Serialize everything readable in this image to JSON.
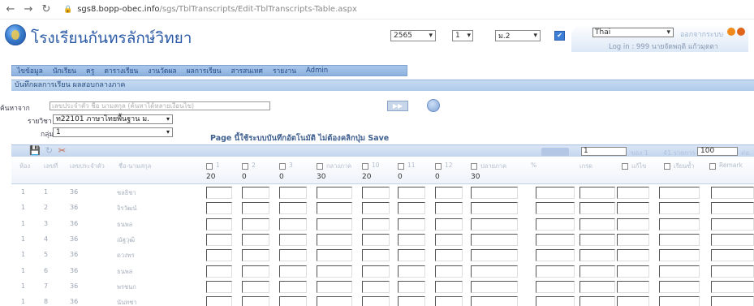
{
  "browser": {
    "back_icon": "back-arrow-icon",
    "forward_icon": "forward-arrow-icon",
    "reload_icon": "reload-icon",
    "lock_icon": "lock-icon",
    "url_host": "sgs8.bopp-obec.info",
    "url_path": "/sgs/TblTranscripts/Edit-TblTranscripts-Table.aspx"
  },
  "header": {
    "school_name": "โรงเรียนกันทรลักษ์วิทยา",
    "year_value": "2565",
    "term_value": "1",
    "class_label": "",
    "level_value": "ม.2",
    "language_value": "Thai",
    "logout_label": "ออกจากระบบ",
    "login_text": "Log in : 999 นายจัดพฤติ แก้วมุตตา"
  },
  "menu": {
    "items": [
      "ไขข้อมูล",
      "นักเรียน",
      "ครู",
      "ตารางเรียน",
      "งานวัดผล",
      "ผลการเรียน",
      "สารสนเทศ",
      "รายงาน",
      "Admin"
    ]
  },
  "section": {
    "title": "บันทึกผลการเรียน ผลสอบกลางภาค"
  },
  "search": {
    "label": "ค้นหาจาก",
    "placeholder": "เลขประจำตัว ชื่อ นามสกุล (ค้นหาได้หลายเงื่อนไข)",
    "subject_label": "รายวิชา",
    "subject_value": "ท22101 ภาษาไทยพื้นฐาน ม.",
    "group_label": "กลุ่ม",
    "group_value": "1",
    "notice": "Page นี้ใช้ระบบบันทึกอัตโนมัติ ไม่ต้องคลิกปุ่ม Save"
  },
  "toolbar": {
    "save_icon": "save-icon",
    "refresh_icon": "refresh-icon",
    "tools_icon": "tools-icon",
    "page_value": "1",
    "page_of": "ของ 1",
    "total_text": "41 รายการ",
    "page_size": "100",
    "per_page": "ต่อหน้า"
  },
  "table": {
    "headers": {
      "room": "ห้อง",
      "number": "เลขที่",
      "student_id": "เลขประจำตัว",
      "name": "ชื่อ-นามสกุล",
      "t1": "1",
      "t2": "2",
      "t3": "3",
      "midterm": "กลางภาค",
      "t10": "10",
      "t11": "11",
      "t12": "12",
      "final": "ปลายภาค",
      "percent": "%",
      "grade": "เกรด",
      "corrected": "แก้ไข",
      "missing": "เรียนซ้ำ",
      "remark": "Remark"
    },
    "max_scores": {
      "t1": "20",
      "t2": "0",
      "t3": "0",
      "midterm": "30",
      "t10": "20",
      "t11": "0",
      "t12": "0",
      "final": "30"
    },
    "rows": [
      {
        "room": "1",
        "no": "1",
        "id": "36",
        "name": "ชลธิชา"
      },
      {
        "room": "1",
        "no": "2",
        "id": "36",
        "name": "จิรวัฒน์"
      },
      {
        "room": "1",
        "no": "3",
        "id": "36",
        "name": "ธนพล"
      },
      {
        "room": "1",
        "no": "4",
        "id": "36",
        "name": "ณัฐวุฒิ"
      },
      {
        "room": "1",
        "no": "5",
        "id": "36",
        "name": "ดวงพร"
      },
      {
        "room": "1",
        "no": "6",
        "id": "36",
        "name": "ธนพล"
      },
      {
        "room": "1",
        "no": "7",
        "id": "36",
        "name": "พรชนก"
      },
      {
        "room": "1",
        "no": "8",
        "id": "36",
        "name": "นันทชา"
      }
    ]
  }
}
